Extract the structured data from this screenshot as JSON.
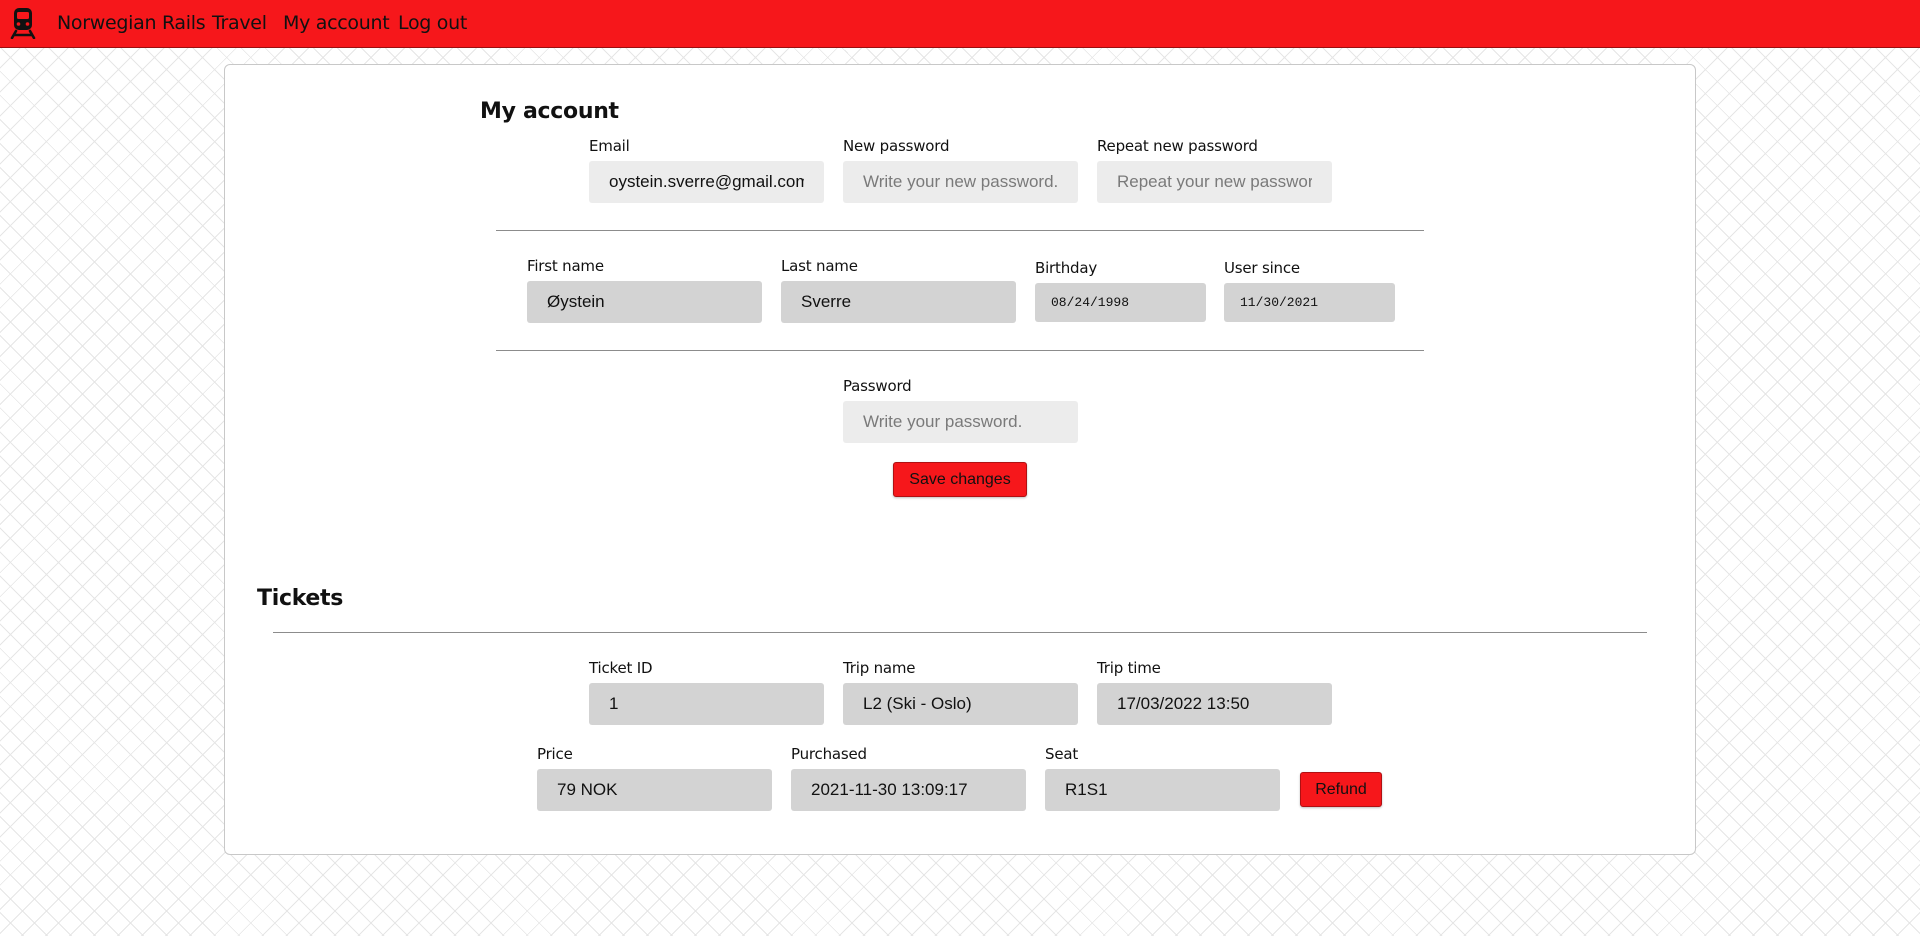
{
  "nav": {
    "brand": "Norwegian Rails",
    "links": [
      "Travel",
      "My account",
      "Log out"
    ],
    "logo_icon": "train-icon",
    "color": "#f6171b"
  },
  "account": {
    "title": "My account",
    "email": {
      "label": "Email",
      "value": "oystein.sverre@gmail.com"
    },
    "new_password": {
      "label": "New password",
      "placeholder": "Write your new password."
    },
    "repeat_password": {
      "label": "Repeat new password",
      "placeholder": "Repeat your new password"
    },
    "first_name": {
      "label": "First name",
      "value": "Øystein"
    },
    "last_name": {
      "label": "Last name",
      "value": "Sverre"
    },
    "birthday": {
      "label": "Birthday",
      "value": "08/24/1998"
    },
    "user_since": {
      "label": "User since",
      "value": "11/30/2021"
    },
    "password": {
      "label": "Password",
      "placeholder": "Write your password."
    },
    "save_label": "Save changes"
  },
  "tickets": {
    "title": "Tickets",
    "items": [
      {
        "ticket_id": {
          "label": "Ticket ID",
          "value": "1"
        },
        "trip_name": {
          "label": "Trip name",
          "value": "L2 (Ski - Oslo)"
        },
        "trip_time": {
          "label": "Trip time",
          "value": "17/03/2022 13:50"
        },
        "price": {
          "label": "Price",
          "value": "79 NOK"
        },
        "purchased": {
          "label": "Purchased",
          "value": "2021-11-30 13:09:17"
        },
        "seat": {
          "label": "Seat",
          "value": "R1S1"
        },
        "refund_label": "Refund"
      }
    ]
  }
}
